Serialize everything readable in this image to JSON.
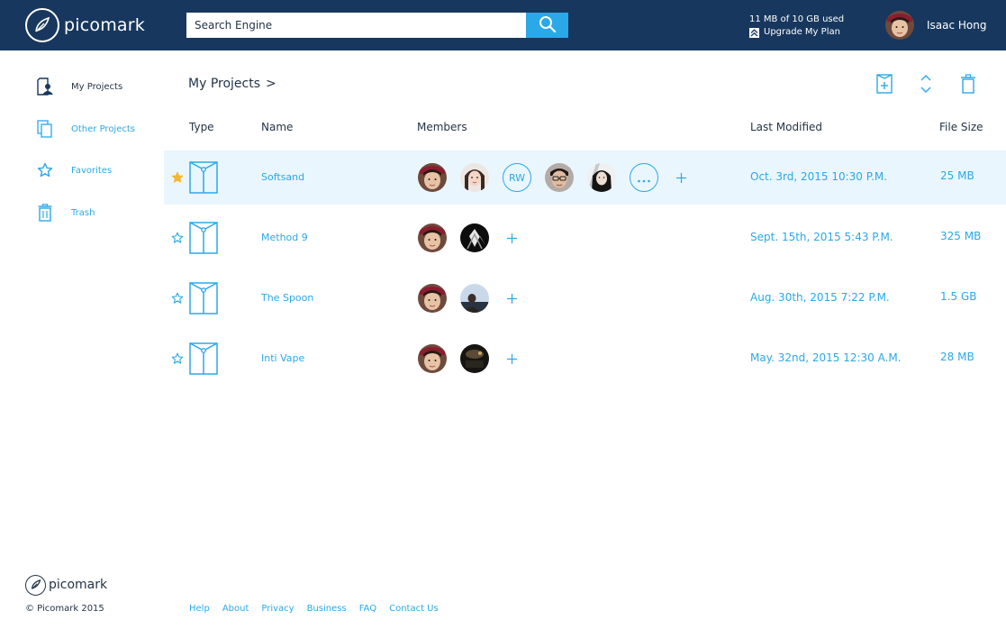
{
  "brand": {
    "name": "picomark",
    "footer_name": "picomark",
    "copyright": "© Picomark 2015"
  },
  "search": {
    "placeholder": "Search Engine"
  },
  "plan": {
    "usage": "11 MB of 10 GB used",
    "upgrade_label": "Upgrade My Plan"
  },
  "user": {
    "name": "Isaac Hong"
  },
  "sidebar": {
    "items": [
      {
        "label": "My Projects",
        "icon": "user-folder-icon",
        "active": true
      },
      {
        "label": "Other Projects",
        "icon": "documents-icon",
        "active": false
      },
      {
        "label": "Favorites",
        "icon": "star-icon",
        "active": false
      },
      {
        "label": "Trash",
        "icon": "trash-icon",
        "active": false
      }
    ]
  },
  "main": {
    "breadcrumb": "My Projects",
    "breadcrumb_chevron": ">",
    "toolbar": [
      "new-project-icon",
      "sort-icon",
      "trash-icon"
    ],
    "columns": {
      "type": "Type",
      "name": "Name",
      "members": "Members",
      "modified": "Last Modified",
      "size": "File Size"
    },
    "rows": [
      {
        "name": "Softsand",
        "starred": true,
        "selected": true,
        "modified": "Oct. 3rd, 2015 10:30 P.M.",
        "size": "25 MB",
        "rw_label": "RW"
      },
      {
        "name": "Method 9",
        "starred": false,
        "selected": false,
        "modified": "Sept. 15th, 2015 5:43 P.M.",
        "size": "325 MB"
      },
      {
        "name": "The Spoon",
        "starred": false,
        "selected": false,
        "modified": "Aug. 30th, 2015 7:22 P.M.",
        "size": "1.5 GB"
      },
      {
        "name": "Inti Vape",
        "starred": false,
        "selected": false,
        "modified": "May. 32nd, 2015 12:30 A.M.",
        "size": "28 MB"
      }
    ]
  },
  "footer": {
    "links": [
      {
        "label": "Help"
      },
      {
        "label": "About"
      },
      {
        "label": "Privacy"
      },
      {
        "label": "Business"
      },
      {
        "label": "FAQ"
      },
      {
        "label": "Contact Us"
      }
    ]
  },
  "colors": {
    "header_bg": "#17375e",
    "accent": "#2ba8e8",
    "text": "#243447",
    "selected_row": "#eaf6fd",
    "star_active": "#f5b731"
  }
}
